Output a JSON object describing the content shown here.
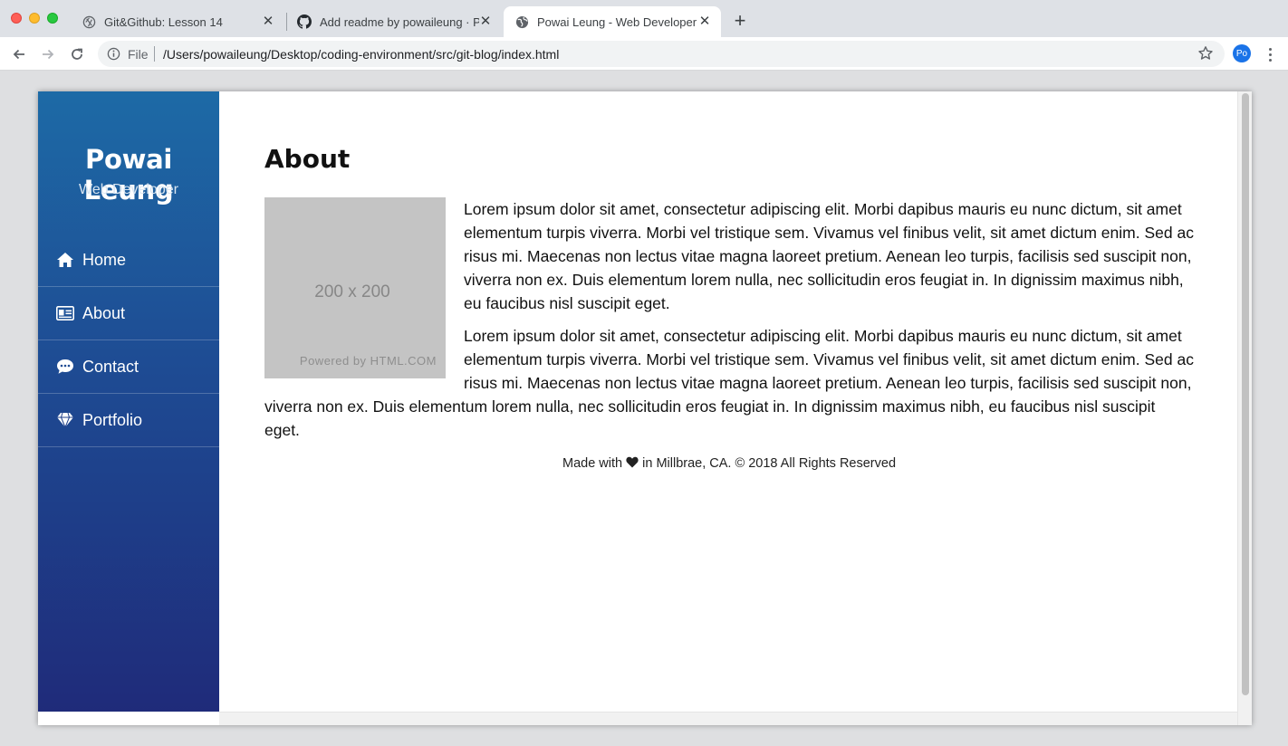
{
  "browser": {
    "tabs": [
      {
        "title": "Git&Github: Lesson 14",
        "icon": "gatsby-icon",
        "active": false
      },
      {
        "title": "Add readme by powaileung · Pull",
        "icon": "github-icon",
        "active": false
      },
      {
        "title": "Powai Leung - Web Developer",
        "icon": "globe-icon",
        "active": true
      }
    ],
    "address": {
      "scheme_label": "File",
      "url": "/Users/powaileung/Desktop/coding-environment/src/git-blog/index.html"
    },
    "profile_initials": "Po"
  },
  "site": {
    "name": "Powai Leung",
    "tagline": "Web Developer",
    "nav": [
      {
        "label": "Home",
        "icon": "home-icon"
      },
      {
        "label": "About",
        "icon": "id-card-icon"
      },
      {
        "label": "Contact",
        "icon": "chat-bubble-icon"
      },
      {
        "label": "Portfolio",
        "icon": "diamond-icon"
      }
    ],
    "accent_top": "#1d6aa6",
    "accent_bottom": "#1f2b7a"
  },
  "main": {
    "heading": "About",
    "image": {
      "size_text": "200 x 200",
      "credit": "Powered by HTML.COM"
    },
    "paragraphs": [
      "Lorem ipsum dolor sit amet, consectetur adipiscing elit. Morbi dapibus mauris eu nunc dictum, sit amet elementum turpis viverra. Morbi vel tristique sem. Vivamus vel finibus velit, sit amet dictum enim. Sed ac risus mi. Maecenas non lectus vitae magna laoreet pretium. Aenean leo turpis, facilisis sed suscipit non, viverra non ex. Duis elementum lorem nulla, nec sollicitudin eros feugiat in. In dignissim maximus nibh, eu faucibus nisl suscipit eget.",
      "Lorem ipsum dolor sit amet, consectetur adipiscing elit. Morbi dapibus mauris eu nunc dictum, sit amet elementum turpis viverra. Morbi vel tristique sem. Vivamus vel finibus velit, sit amet dictum enim. Sed ac risus mi. Maecenas non lectus vitae magna laoreet pretium. Aenean leo turpis, facilisis sed suscipit non, viverra non ex. Duis elementum lorem nulla, nec sollicitudin eros feugiat in. In dignissim maximus nibh, eu faucibus nisl suscipit eget."
    ]
  },
  "footer": {
    "before_heart": "Made with",
    "after_heart": "in Millbrae, CA. © 2018 All Rights Reserved"
  }
}
